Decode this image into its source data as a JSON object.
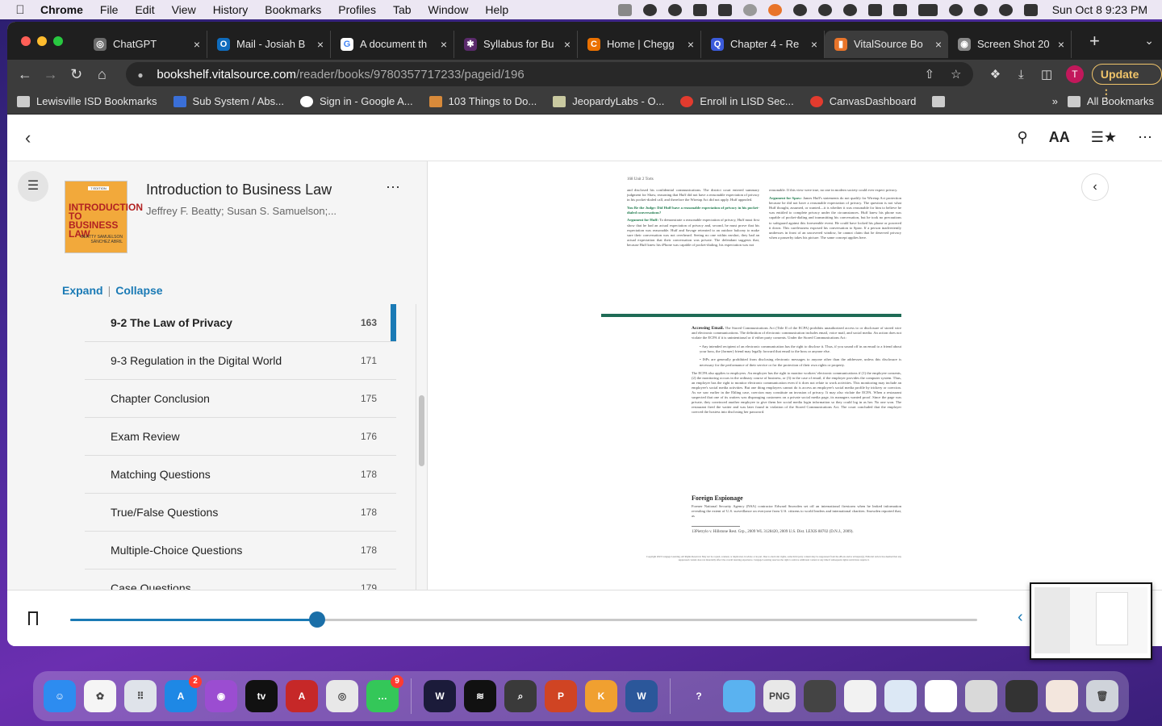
{
  "menubar": {
    "app": "Chrome",
    "items": [
      "File",
      "Edit",
      "View",
      "History",
      "Bookmarks",
      "Profiles",
      "Tab",
      "Window",
      "Help"
    ],
    "clock": "Sun Oct 8  9:23 PM"
  },
  "tabs": [
    {
      "title": "ChatGPT",
      "color": "#6b6b6b",
      "glyph": "◎"
    },
    {
      "title": "Mail - Josiah B",
      "color": "#0f6cbd",
      "glyph": "O"
    },
    {
      "title": "A document th",
      "color": "#ffffff",
      "glyph": "G"
    },
    {
      "title": "Syllabus for Bu",
      "color": "#5a2a6b",
      "glyph": "✱"
    },
    {
      "title": "Home | Chegg",
      "color": "#eb7100",
      "glyph": "C"
    },
    {
      "title": "Chapter 4 - Re",
      "color": "#3b5bdb",
      "glyph": "Q"
    },
    {
      "title": "VitalSource Bo",
      "color": "#e8742a",
      "glyph": "▮"
    },
    {
      "title": "Screen Shot 20",
      "color": "#888888",
      "glyph": "◉"
    }
  ],
  "address": {
    "domain": "bookshelf.vitalsource.com",
    "path": "/reader/books/9780357717233/pageid/196"
  },
  "update_label": "Update",
  "profile_initial": "T",
  "bookmarks": [
    "Lewisville ISD Bookmarks",
    "Sub System / Abs...",
    "Sign in - Google A...",
    "103 Things to Do...",
    "JeopardyLabs - O...",
    "Enroll in LISD Sec...",
    "CanvasDashboard"
  ],
  "bookmarks_all": "All Bookmarks",
  "book": {
    "title": "Introduction to Business Law",
    "authors": "Jeffrey F. Beatty; Susan S. Samuelson;...",
    "cover_edition": "7 EDITION",
    "cover_title": "INTRODUCTION TO BUSINESS LAW",
    "cover_authors": "BEATTY SAMUELSON SÁNCHEZ ABRIL"
  },
  "toc_controls": {
    "expand": "Expand",
    "collapse": "Collapse"
  },
  "toc": [
    {
      "label": "9-2 The Law of Privacy",
      "page": "163"
    },
    {
      "label": "9-3 Regulation in the Digital World",
      "page": "171"
    },
    {
      "label": "Chapter Conclusion",
      "page": "175"
    },
    {
      "label": "Exam Review",
      "page": "176"
    },
    {
      "label": "Matching Questions",
      "page": "178"
    },
    {
      "label": "True/False Questions",
      "page": "178"
    },
    {
      "label": "Multiple-Choice Questions",
      "page": "178"
    },
    {
      "label": "Case Questions",
      "page": "179"
    }
  ],
  "page": {
    "header": "168        Unit 2   Torts",
    "col1": "and disclosed his confidential communications. The district court entered summary judgment for Shaw, reasoning that Huff did not have a reasonable expectation of privacy in his pocket-dialed call, and therefore the Wiretap Act did not apply. Huff appealed.",
    "judge_q": "You Be the Judge: Did Huff have a reasonable expectation of privacy in his pocket-dialed conversations?",
    "arg_huff_label": "Argument for Huff:",
    "arg_huff": "To demonstrate a reasonable expectation of privacy, Huff must first show that he had an actual expectation of privacy and, second, he must prove that his expectation was reasonable. Huff and Savage retreated to an outdoor balcony to make sure their conversation was not overheard. Seeing no one within earshot, they had an actual expectation that their conversation was private. The defendant suggests that, because Huff knew his iPhone was capable of pocket-dialing, his expectation was not",
    "col2": "reasonable. If this view were true, no one in modern society could ever expect privacy.",
    "arg_spaw_label": "Argument for Spaw:",
    "arg_spaw": "James Huff's statements do not qualify for Wiretap Act protection because he did not have a reasonable expectation of privacy. The question is not what Huff thought, assumed, or wanted—it is whether it was reasonable for him to believe he was entitled to complete privacy under the circumstances. Huff knew his phone was capable of pocket-dialing and transmitting his conversation, but he took no precautions to safeguard against this foreseeable event. He could have locked his phone or powered it down. This carelessness exposed his conversation to Spaw. If a person inadvertently undresses in front of an uncovered window, he cannot claim that he deserved privacy when a passerby takes his picture. The same concept applies here.",
    "email_head": "Accessing Email.",
    "email_body": "The Stored Communications Act (Title II of the ECPA) prohibits unauthorized access to or disclosure of stored wire and electronic communications. The definition of electronic communication includes email, voice mail, and social media. An action does not violate the ECPA if it is unintentional or if either party consents. Under the Stored Communications Act:",
    "bullet1": "Any intended recipient of an electronic communication has the right to disclose it. Thus, if you sound off in an email to a friend about your boss, the (former) friend may legally forward that email to the boss or anyone else.",
    "bullet2": "ISPs are generally prohibited from disclosing electronic messages to anyone other than the addressee, unless this disclosure is necessary for the performance of their service or for the protection of their own rights or property.",
    "ecpa_body": "The ECPA also applies to employers. An employer has the right to monitor workers' electronic communications if (1) the employee consents, (2) the monitoring occurs in the ordinary course of business, or (3) in the case of email, if the employer provides the computer system. Thus, an employer has the right to monitor electronic communication even if it does not relate to work activities. This monitoring may include an employee's social media activities. But one thing employers cannot do is access an employee's social media profile by trickery or coercion. As we saw earlier in the Ehling case, coercion may constitute an invasion of privacy. It may also violate the ECPA. When a restaurant suspected that one of its waiters was disparaging customers on a private social media page, its managers wanted proof. Since the page was private, they convinced another employee to give them her social media login information so they could log in as her. No one won. The restaurant fired the waiter and was later found in violation of the Stored Communications Act. The court concluded that the employer coerced the hostess into disclosing her password.",
    "espionage_head": "Foreign Espionage",
    "espionage_body": "Former National Security Agency (NSA) contractor Edward Snowden set off an international firestorm when he leaked information revealing the extent of U.S. surveillance on everyone from U.S. citizens to world leaders and international charities. Snowden reported that, as",
    "footnote": "13Pietrylo v. Hillstone Rest. Grp., 2009 WL 3128420, 2009 U.S. Dist. LEXIS 88702 (D.N.J., 2009).",
    "copyright": "Copyright 2023 Cengage Learning. All Rights Reserved. May not be copied, scanned, or duplicated, in whole or in part. Due to electronic rights, some third party content may be suppressed from the eBook and/or eChapter(s). Editorial review has deemed that any suppressed content does not materially affect the overall learning experience. Cengage Learning reserves the right to remove additional content at any time if subsequent rights restrictions require it."
  },
  "progress": {
    "fraction": 0.272
  },
  "dock": [
    {
      "name": "finder-icon",
      "color": "#2d8cf0",
      "glyph": "☺"
    },
    {
      "name": "launchpad-photos-icon",
      "color": "#f5f5f5",
      "glyph": "✿"
    },
    {
      "name": "launchpad-icon",
      "color": "#dfe3ea",
      "glyph": "⠿"
    },
    {
      "name": "app-store-icon",
      "color": "#1e88e5",
      "glyph": "A",
      "badge": "2"
    },
    {
      "name": "podcasts-icon",
      "color": "#9b4dd1",
      "glyph": "◉"
    },
    {
      "name": "apple-tv-icon",
      "color": "#111111",
      "glyph": "tv"
    },
    {
      "name": "acrobat-icon",
      "color": "#c62828",
      "glyph": "A"
    },
    {
      "name": "chrome-icon",
      "color": "#e8e8e8",
      "glyph": "◎"
    },
    {
      "name": "messages-icon",
      "color": "#34c759",
      "glyph": "…",
      "badge": "9"
    },
    {
      "name": "webex-icon",
      "color": "#1b1b3a",
      "glyph": "W"
    },
    {
      "name": "spotify-icon",
      "color": "#111111",
      "glyph": "≋"
    },
    {
      "name": "magnifier-icon",
      "color": "#3a3a3a",
      "glyph": "⌕"
    },
    {
      "name": "powerpoint-icon",
      "color": "#d04423",
      "glyph": "P"
    },
    {
      "name": "keynote-icon",
      "color": "#f0a030",
      "glyph": "K"
    },
    {
      "name": "word-icon",
      "color": "#2b579a",
      "glyph": "W"
    },
    {
      "name": "help-icon",
      "color": "transparent",
      "glyph": "?"
    },
    {
      "name": "folder-icon",
      "color": "#5ab2f0",
      "glyph": ""
    },
    {
      "name": "png-file-icon",
      "color": "#e8e8e8",
      "glyph": "PNG"
    },
    {
      "name": "screenshot-thumb-icon",
      "color": "#444444",
      "glyph": ""
    },
    {
      "name": "doc-thumb-icon-1",
      "color": "#f2f2f2",
      "glyph": ""
    },
    {
      "name": "doc-thumb-icon-2",
      "color": "#dce8f5",
      "glyph": ""
    },
    {
      "name": "doc-thumb-icon-3",
      "color": "#ffffff",
      "glyph": ""
    },
    {
      "name": "doc-thumb-icon-4",
      "color": "#d9d9d9",
      "glyph": ""
    },
    {
      "name": "doc-thumb-icon-5",
      "color": "#333333",
      "glyph": ""
    },
    {
      "name": "doc-thumb-icon-6",
      "color": "#f3e6dd",
      "glyph": ""
    },
    {
      "name": "trash-icon",
      "color": "#cfd3da",
      "glyph": "🗑"
    }
  ]
}
